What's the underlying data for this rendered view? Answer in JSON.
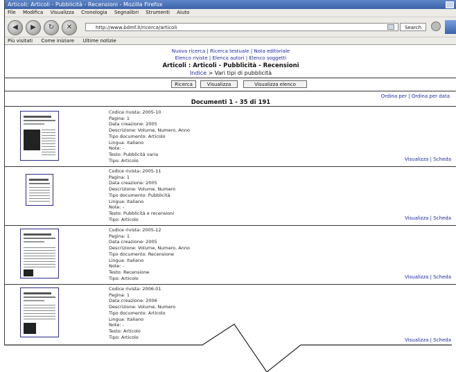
{
  "window": {
    "title": "Articoli: Articoli - Pubblicità - Recensioni - Mozilla Firefox"
  },
  "menubar": {
    "items": [
      "File",
      "Modifica",
      "Visualizza",
      "Cronologia",
      "Segnalibri",
      "Strumenti",
      "Aiuto"
    ]
  },
  "navbar": {
    "address": "http://www.bdmf.it/ricerca/articoli",
    "search_label": "Search"
  },
  "bookmarks": {
    "items": [
      "Più visitati",
      "Come iniziare",
      "Ultime notizie"
    ]
  },
  "page": {
    "top_links": "Nuova ricerca | Ricerca testuale | Nota editoriale",
    "sub_links": "Elenco riviste | Elenco autori | Elenco soggetti",
    "title": "Articoli : Articoli - Pubblicità - Recensioni",
    "subtitle_link": "Indice",
    "subtitle_rest": " > Vari tipi di pubblicità",
    "buttons": [
      "Ricerca",
      "Visualizza",
      "Visualizza elenco"
    ],
    "sort_links": "Ordina per | Ordina per data",
    "documents_label": "Documenti 1 - 35 di 191"
  },
  "records": [
    {
      "fields": [
        "Codice rivista: 2005-10",
        "Pagina: 1",
        "Data creazione: 2005",
        "Descrizione: Volume, Numero, Anno",
        "Tipo documento: Articolo",
        "Lingua: Italiano",
        "Note: -",
        "Testo: Pubblicità varia",
        "Tipo: Articolo"
      ],
      "links": "Visualizza | Scheda"
    },
    {
      "fields": [
        "Codice rivista: 2005-11",
        "Pagina: 1",
        "Data creazione: 2005",
        "Descrizione: Volume, Numero",
        "Tipo documento: Pubblicità",
        "Lingua: Italiano",
        "Note: -",
        "Testo: Pubblicità e recensioni",
        "Tipo: Articolo"
      ],
      "links": "Visualizza | Scheda"
    },
    {
      "fields": [
        "Codice rivista: 2005-12",
        "Pagina: 1",
        "Data creazione: 2005",
        "Descrizione: Volume, Numero, Anno",
        "Tipo documento: Recensione",
        "Lingua: Italiano",
        "Note: -",
        "Testo: Recensione",
        "Tipo: Articolo"
      ],
      "links": "Visualizza | Scheda"
    },
    {
      "fields": [
        "Codice rivista: 2006-01",
        "Pagina: 1",
        "Data creazione: 2006",
        "Descrizione: Volume, Numero",
        "Tipo documento: Articolo",
        "Lingua: Italiano",
        "Note: -",
        "Testo: Articolo",
        "Tipo: Articolo"
      ],
      "links": "Visualizza | Scheda"
    }
  ]
}
